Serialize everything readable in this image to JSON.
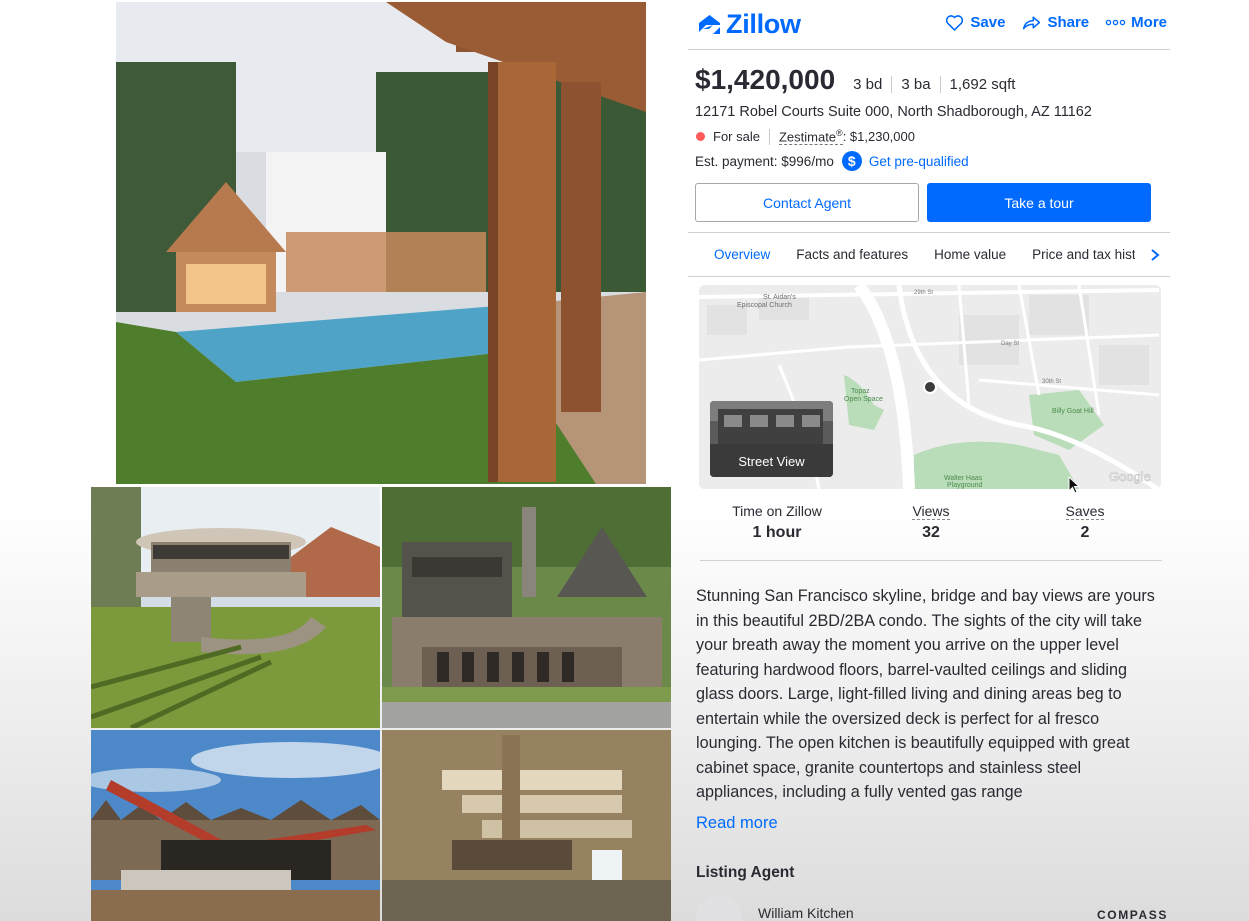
{
  "brand": {
    "name": "Zillow",
    "color": "#006aff"
  },
  "header": {
    "actions": [
      {
        "label": "Save",
        "icon": "heart-icon"
      },
      {
        "label": "Share",
        "icon": "share-icon"
      },
      {
        "label": "More",
        "icon": "more-dots-icon"
      }
    ]
  },
  "listing": {
    "price": "$1,420,000",
    "beds": "3 bd",
    "baths": "3 ba",
    "sqft": "1,692 sqft",
    "address": "12171 Robel Courts Suite 000, North Shadborough, AZ 11162",
    "status": "For sale",
    "status_color": "#ff5a5a",
    "zestimate_label": "Zestimate",
    "zestimate_mark": "®",
    "zestimate_value": ": $1,230,000",
    "payment": "Est. payment: $996/mo",
    "payment_icon": "$",
    "prequal": "Get pre-qualified"
  },
  "buttons": {
    "contact": "Contact Agent",
    "tour": "Take a tour"
  },
  "tabs": [
    {
      "label": "Overview",
      "active": true
    },
    {
      "label": "Facts and features"
    },
    {
      "label": "Home value"
    },
    {
      "label": "Price and tax history"
    }
  ],
  "map": {
    "street_view": "Street View",
    "labels": {
      "church": "St. Aidan's",
      "church2": "Episcopal Church",
      "park": "Topaz",
      "park2": "Open Space",
      "hill": "Billy Goat Hill",
      "playground": "Walter Haas",
      "playground2": "Playground",
      "st29": "29th St",
      "st30": "30th St",
      "day": "Day St",
      "google": "Google"
    }
  },
  "stats": [
    {
      "label": "Time on Zillow",
      "value": "1 hour",
      "dashed": false
    },
    {
      "label": "Views",
      "value": "32",
      "dashed": true
    },
    {
      "label": "Saves",
      "value": "2",
      "dashed": true
    }
  ],
  "description": "Stunning San Francisco skyline, bridge and bay views are yours in this beautiful 2BD/2BA condo. The sights of the city will take your breath away the moment you arrive on the upper level featuring hardwood floors, barrel-vaulted ceilings and sliding glass doors. Large, light-filled living and dining areas beg to entertain while the oversized deck is perfect for al fresco lounging. The open kitchen is beautifully equipped with great cabinet space, granite countertops and stainless steel appliances, including a fully vented gas range",
  "read_more": "Read more",
  "agent": {
    "heading": "Listing Agent",
    "name": "William Kitchen",
    "brokerage": "COMPASS"
  }
}
